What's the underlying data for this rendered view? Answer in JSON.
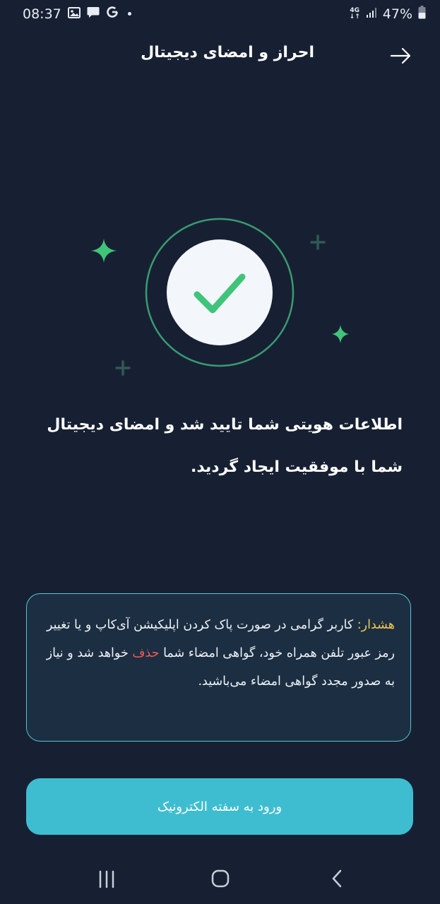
{
  "status_bar": {
    "time": "08:37",
    "network_type_top": "4G",
    "network_type_bottom": "↓↑",
    "battery": "47%",
    "icons": [
      "image-icon",
      "message-icon",
      "google-icon",
      "dot-icon",
      "signal-icon",
      "battery-icon"
    ]
  },
  "header": {
    "title": "احراز و امضای دیجیتال",
    "back_icon": "arrow-right-icon"
  },
  "illustration": {
    "icon": "check-icon",
    "accent_color": "#3fc47a",
    "decor_icons": [
      "sparkle-icon",
      "sparkle-icon",
      "plus-icon",
      "plus-icon"
    ]
  },
  "message": {
    "line1": "اطلاعات هویتی شما تایید شد و امضای دیجیتال",
    "line2": "شما با موفقیت ایجاد گردید."
  },
  "warning": {
    "label": "هشدار:",
    "text1": " کاربر گرامی در صورت پاک کردن اپلیکیشن آی‌کاپ و یا تغییر رمز عبور تلفن همراه خود، گواهی امضاء شما ",
    "delete_word": "حذف",
    "text2": " خواهد شد و نیاز به صدور مجدد گواهی امضاء می‌باشید.",
    "label_color": "#f2c84b",
    "delete_color": "#ef5a55",
    "border_color": "#56c6d3"
  },
  "primary_button": {
    "label": "ورود به سفته الکترونیک",
    "color": "#3fbdd0"
  },
  "nav_bar": {
    "icons": [
      "recent-apps-icon",
      "home-icon",
      "back-icon"
    ]
  },
  "colors": {
    "background": "#172033"
  }
}
